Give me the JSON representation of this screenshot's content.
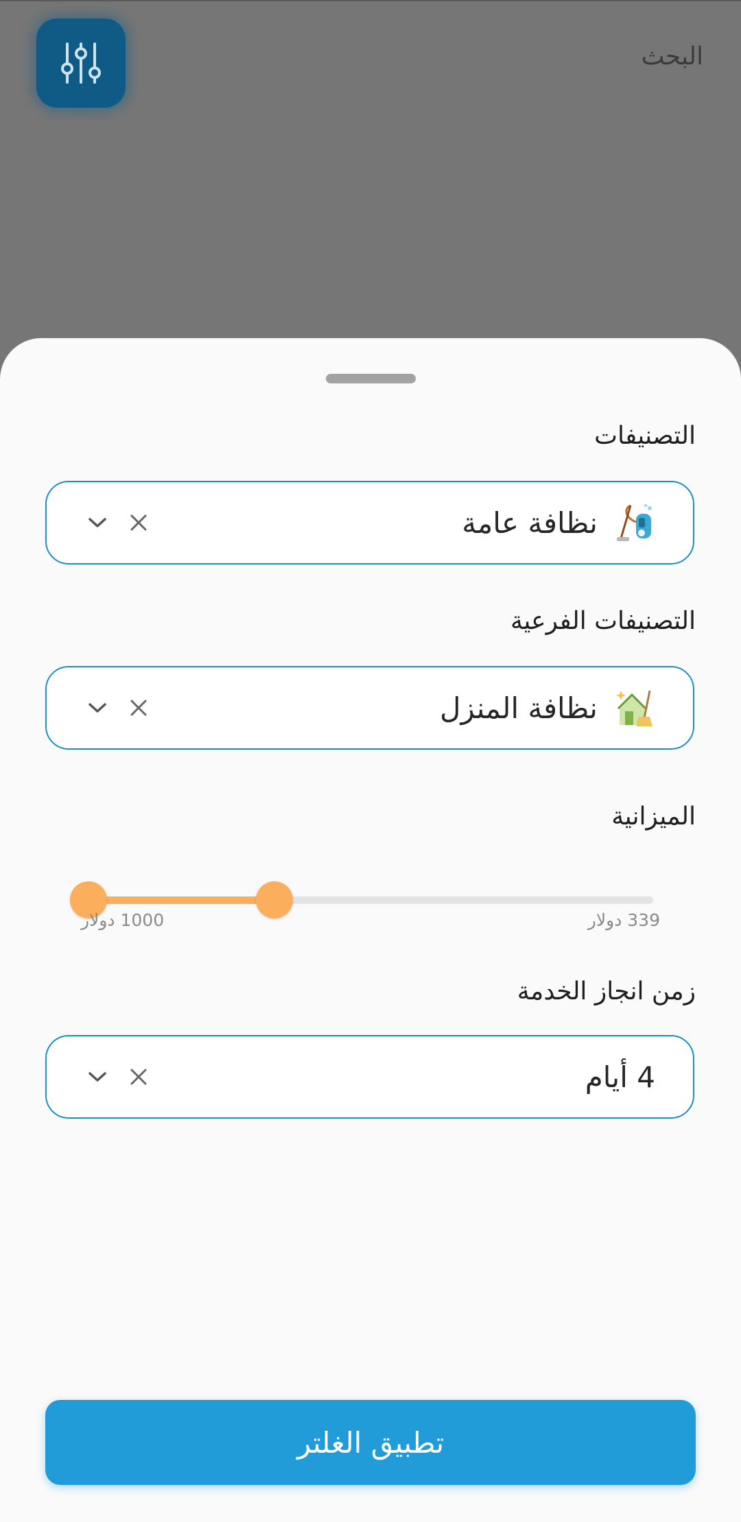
{
  "header": {
    "title": "البحث",
    "filter_icon": "sliders-icon"
  },
  "sheet": {
    "categories": {
      "label": "التصنيفات",
      "selected": "نظافة عامة",
      "icon": "vacuum-cleaner-icon"
    },
    "subcategories": {
      "label": "التصنيفات الفرعية",
      "selected": "نظافة المنزل",
      "icon": "house-cleaning-icon"
    },
    "budget": {
      "label": "الميزانية",
      "min_label": "339 دولار",
      "max_label": "1000 دولار",
      "min_value": 339,
      "max_value": 1000,
      "selected_fraction_start": 0.66,
      "selected_fraction_end": 1.0,
      "accent_color": "#fbae5c"
    },
    "delivery_time": {
      "label": "زمن انجاز الخدمة",
      "selected": "4 أيام"
    },
    "apply_button": "تطبيق الغلتر"
  },
  "colors": {
    "primary": "#229bd9",
    "border": "#1b8fc4",
    "fab": "#0f5b85"
  }
}
